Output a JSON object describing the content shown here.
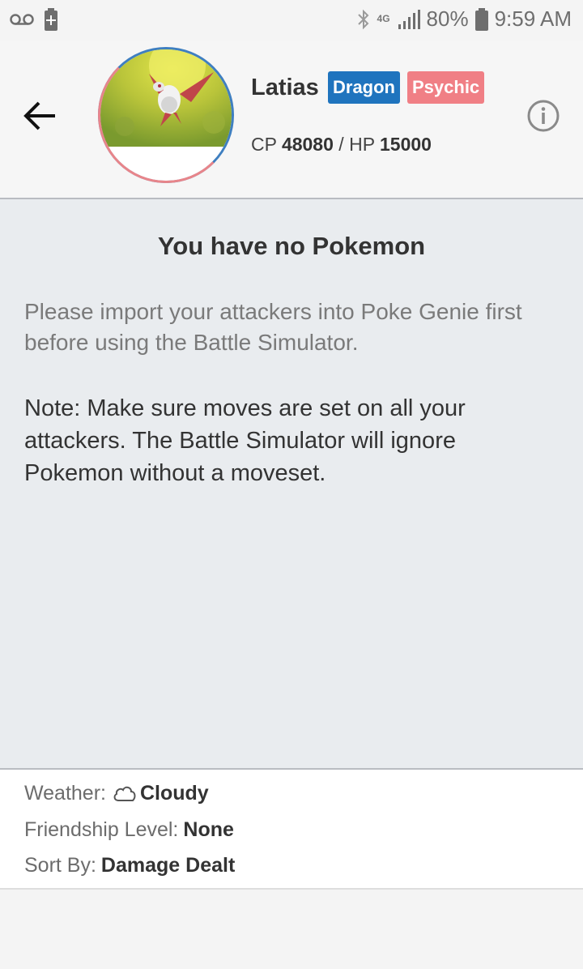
{
  "status_bar": {
    "battery_percent": "80%",
    "time": "9:59 AM",
    "network_label": "4G"
  },
  "header": {
    "name": "Latias",
    "types": [
      "Dragon",
      "Psychic"
    ],
    "cp_label": "CP",
    "cp_value": "48080",
    "separator": "/",
    "hp_label": "HP",
    "hp_value": "15000",
    "type_colors": {
      "dragon": "#1f74be",
      "psychic": "#f07f85"
    }
  },
  "main": {
    "title": "You have no Pokemon",
    "message": "Please import your attackers into Poke Genie first before using the Battle Simulator.",
    "note": "Note: Make sure moves are set on all your attackers. The Battle Simulator will ignore Pokemon without a moveset."
  },
  "settings": {
    "weather_label": "Weather:",
    "weather_value": "Cloudy",
    "weather_icon": "cloud-icon",
    "friendship_label": "Friendship Level:",
    "friendship_value": "None",
    "sort_label": "Sort By:",
    "sort_value": "Damage Dealt"
  }
}
